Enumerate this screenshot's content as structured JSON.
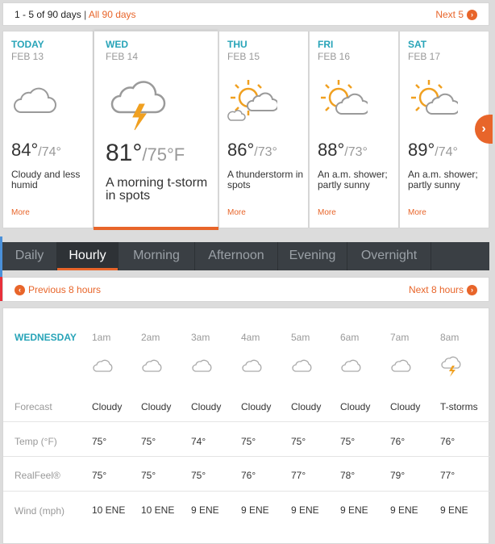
{
  "topbar": {
    "range": "1 - 5 of 90 days",
    "sep": "|",
    "all": "All 90 days",
    "next": "Next 5"
  },
  "days": [
    {
      "name": "TODAY",
      "date": "FEB 13",
      "hi": "84°",
      "lo": "/74°",
      "desc": "Cloudy and less humid",
      "more": "More",
      "icon": "cloud-icon"
    },
    {
      "name": "WED",
      "date": "FEB 14",
      "hi": "81°",
      "lo": "/75°F",
      "desc": "A morning t-storm in spots",
      "more": "",
      "icon": "thunderstorm-icon"
    },
    {
      "name": "THU",
      "date": "FEB 15",
      "hi": "86°",
      "lo": "/73°",
      "desc": "A thunderstorm in spots",
      "more": "More",
      "icon": "sun-cloud-icon"
    },
    {
      "name": "FRI",
      "date": "FEB 16",
      "hi": "88°",
      "lo": "/73°",
      "desc": "An a.m. shower; partly sunny",
      "more": "More",
      "icon": "sun-cloud-icon"
    },
    {
      "name": "SAT",
      "date": "FEB 17",
      "hi": "89°",
      "lo": "/74°",
      "desc": "An a.m. shower; partly sunny",
      "more": "More",
      "icon": "sun-cloud-icon"
    }
  ],
  "tabs": [
    "Daily",
    "Hourly",
    "Morning",
    "Afternoon",
    "Evening",
    "Overnight"
  ],
  "hnav": {
    "prev": "Previous 8 hours",
    "next": "Next 8 hours"
  },
  "hourly": {
    "weekday": "WEDNESDAY",
    "hours": [
      "1am",
      "2am",
      "3am",
      "4am",
      "5am",
      "6am",
      "7am",
      "8am"
    ],
    "icons": [
      "cloud-icon",
      "cloud-icon",
      "cloud-icon",
      "cloud-icon",
      "cloud-icon",
      "cloud-icon",
      "cloud-icon",
      "thunderstorm-icon"
    ],
    "rows": [
      {
        "label": "Forecast",
        "values": [
          "Cloudy",
          "Cloudy",
          "Cloudy",
          "Cloudy",
          "Cloudy",
          "Cloudy",
          "Cloudy",
          "T-storms"
        ]
      },
      {
        "label": "Temp (°F)",
        "values": [
          "75°",
          "75°",
          "74°",
          "75°",
          "75°",
          "75°",
          "76°",
          "76°"
        ]
      },
      {
        "label": "RealFeel®",
        "values": [
          "75°",
          "75°",
          "75°",
          "76°",
          "77°",
          "78°",
          "79°",
          "77°"
        ]
      },
      {
        "label": "Wind (mph)",
        "values": [
          "10 ENE",
          "10 ENE",
          "9 ENE",
          "9 ENE",
          "9 ENE",
          "9 ENE",
          "9 ENE",
          "9 ENE"
        ]
      }
    ]
  },
  "colors": {
    "accent": "#e8652a",
    "teal": "#28a4b8",
    "tabbar": "#3a3f44"
  }
}
